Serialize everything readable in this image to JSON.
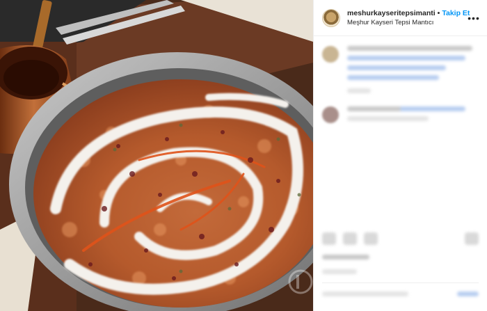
{
  "post": {
    "username": "meshurkayseritepsimanti",
    "separator": "•",
    "follow_label": "Takip Et",
    "location": "Meşhur Kayseri Tepsi Mantıcı",
    "more_icon": "more-options-icon",
    "image_alt": "Kayseri tepsi mantısı"
  },
  "colors": {
    "follow": "#0095f6",
    "text": "#262626",
    "divider": "#efefef"
  }
}
